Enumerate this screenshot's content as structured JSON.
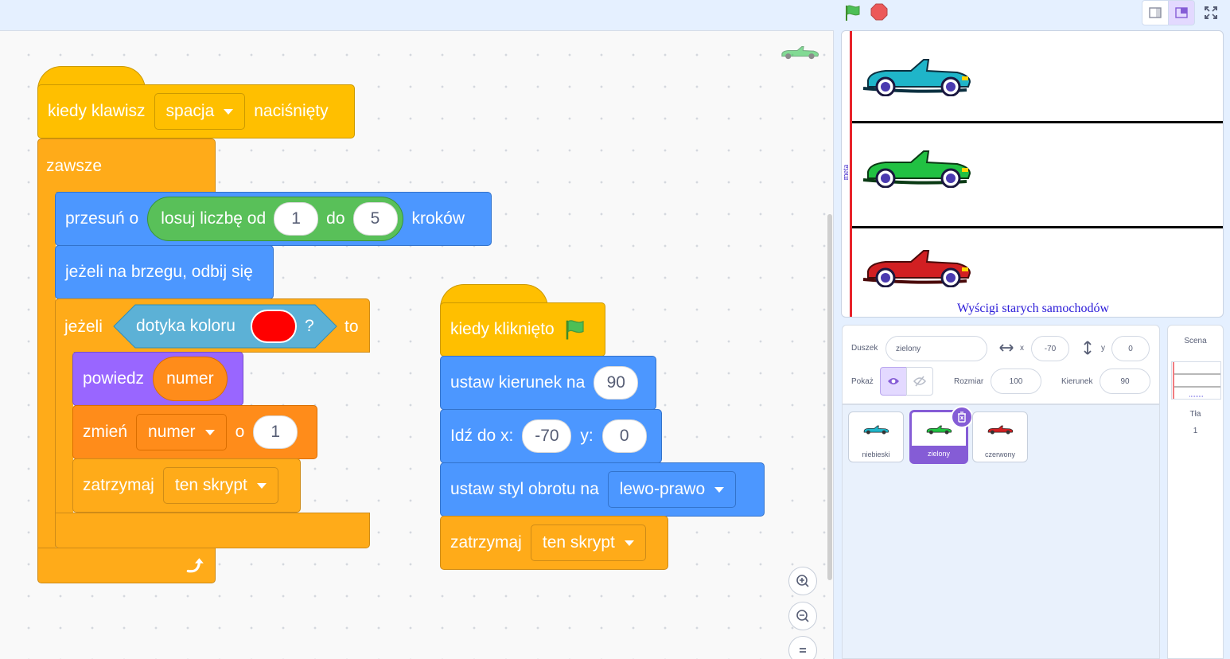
{
  "scripts": {
    "script1": {
      "hat": {
        "pre": "kiedy klawisz",
        "key": "spacja",
        "post": "naciśnięty"
      },
      "forever": "zawsze",
      "move": {
        "pre": "przesuń o",
        "rand_label": "losuj liczbę od",
        "from": "1",
        "to_label": "do",
        "to": "5",
        "post": "kroków"
      },
      "bounce": "jeżeli na brzegu, odbij się",
      "if": {
        "pre": "jeżeli",
        "sense": "dotyka koloru",
        "q": "?",
        "post": "to",
        "color": "#ff0000"
      },
      "say": {
        "pre": "powiedz",
        "var": "numer"
      },
      "change": {
        "pre": "zmień",
        "var": "numer",
        "by": "o",
        "value": "1"
      },
      "stop": {
        "pre": "zatrzymaj",
        "option": "ten skrypt"
      }
    },
    "script2": {
      "hat": "kiedy kliknięto",
      "point": {
        "pre": "ustaw kierunek na",
        "value": "90"
      },
      "goto": {
        "pre": "Idź do x:",
        "x": "-70",
        "ylabel": "y:",
        "y": "0"
      },
      "rotation": {
        "pre": "ustaw styl obrotu na",
        "option": "lewo-prawo"
      },
      "stop": {
        "pre": "zatrzymaj",
        "option": "ten skrypt"
      }
    }
  },
  "stage": {
    "title": "Wyścigi starych samochodów",
    "finish_label": "meta",
    "cars": [
      {
        "name": "niebieski",
        "color": "#1fb5c9"
      },
      {
        "name": "zielony",
        "color": "#21c142"
      },
      {
        "name": "czerwony",
        "color": "#d11f22"
      }
    ]
  },
  "sprite_info": {
    "sprite_label": "Duszek",
    "sprite_name": "zielony",
    "x_label": "x",
    "x": "-70",
    "y_label": "y",
    "y": "0",
    "show_label": "Pokaż",
    "size_label": "Rozmiar",
    "size": "100",
    "direction_label": "Kierunek",
    "direction": "90"
  },
  "sprites": [
    {
      "name": "niebieski",
      "color": "#1fb5c9"
    },
    {
      "name": "zielony",
      "color": "#21c142",
      "selected": true
    },
    {
      "name": "czerwony",
      "color": "#d11f22"
    }
  ],
  "stage_pane": {
    "title": "Scena",
    "backdrops_label": "Tła",
    "backdrops_count": "1"
  },
  "colors": {
    "events": "#ffbf00",
    "control": "#ffab19",
    "motion": "#4c97ff",
    "looks": "#9966ff",
    "variables": "#ff8c1a",
    "operators": "#59c059",
    "sensing": "#5cb1d6",
    "accent": "#855cd6"
  }
}
